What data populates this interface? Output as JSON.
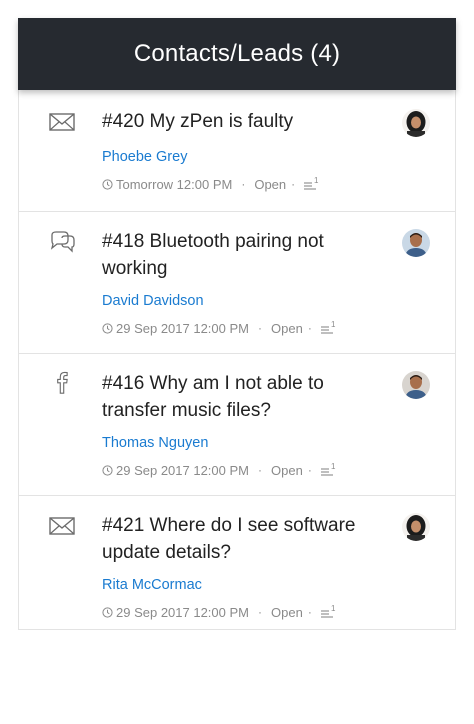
{
  "header": {
    "title": "Contacts/Leads (4)"
  },
  "colors": {
    "header_bg": "#262a30",
    "link": "#1a7bd0",
    "meta": "#8a8a8a"
  },
  "tickets": [
    {
      "channel_icon": "envelope-icon",
      "subject": "#420 My zPen is faulty",
      "contact": "Phoebe Grey",
      "due": "Tomorrow 12:00 PM",
      "status": "Open",
      "avatar": "female-avatar"
    },
    {
      "channel_icon": "chat-bubbles-icon",
      "subject": "#418 Bluetooth pairing not working",
      "contact": "David Davidson",
      "due": "29 Sep 2017 12:00 PM",
      "status": "Open",
      "avatar": "male-avatar"
    },
    {
      "channel_icon": "facebook-icon",
      "subject": "#416 Why am I not able to transfer music files?",
      "contact": "Thomas Nguyen",
      "due": "29 Sep 2017 12:00 PM",
      "status": "Open",
      "avatar": "male-avatar"
    },
    {
      "channel_icon": "envelope-icon",
      "subject": "#421 Where do I see software update details?",
      "contact": "Rita McCormac",
      "due": "29 Sep 2017 12:00 PM",
      "status": "Open",
      "avatar": "female-avatar"
    }
  ],
  "priority_badge": "1"
}
